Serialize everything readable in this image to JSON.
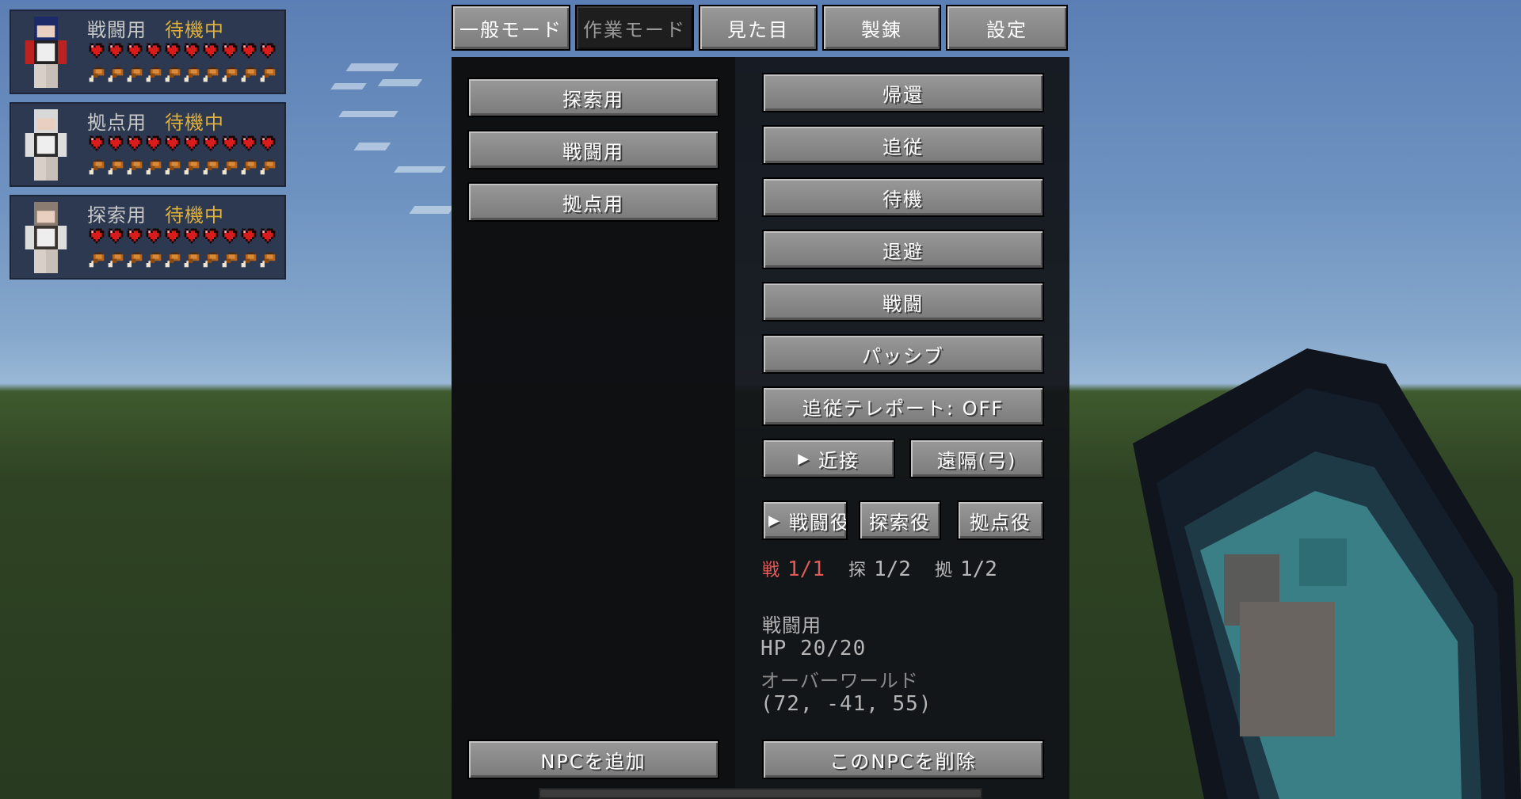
{
  "party": [
    {
      "name": "戦闘用",
      "status": "待機中",
      "hearts": 10,
      "food": 10
    },
    {
      "name": "拠点用",
      "status": "待機中",
      "hearts": 10,
      "food": 10
    },
    {
      "name": "探索用",
      "status": "待機中",
      "hearts": 10,
      "food": 10
    }
  ],
  "tabs": [
    {
      "label": "一般モード",
      "active": false
    },
    {
      "label": "作業モード",
      "active": true
    },
    {
      "label": "見た目",
      "active": false
    },
    {
      "label": "製錬",
      "active": false
    },
    {
      "label": "設定",
      "active": false
    }
  ],
  "npc_list": [
    "探索用",
    "戦闘用",
    "拠点用"
  ],
  "commands": [
    "帰還",
    "追従",
    "待機",
    "退避",
    "戦闘",
    "パッシブ"
  ],
  "teleport_toggle": "追従テレポート: OFF",
  "combat_style": {
    "melee": "近接",
    "ranged": "遠隔(弓)",
    "selected_flag": "▶"
  },
  "roles": {
    "combat": "戦闘役",
    "explore": "探索役",
    "base": "拠点役",
    "selected_flag": "▶"
  },
  "role_counts": [
    {
      "label": "戦",
      "value": "1/1",
      "color": "#e05a5a"
    },
    {
      "label": "探",
      "value": "1/2",
      "color": "#b8b8b8"
    },
    {
      "label": "拠",
      "value": "1/2",
      "color": "#b8b8b8"
    }
  ],
  "selected_npc": {
    "name": "戦闘用",
    "hp": "HP 20/20",
    "dimension": "オーバーワールド",
    "coords": "(72, -41, 55)"
  },
  "footer": {
    "add_npc": "NPCを追加",
    "delete_npc": "このNPCを削除"
  },
  "colors": {
    "status": "#e0b03a",
    "heart": "#d81c1c",
    "button_face": "#8a8a8a",
    "panel": "#111318"
  }
}
